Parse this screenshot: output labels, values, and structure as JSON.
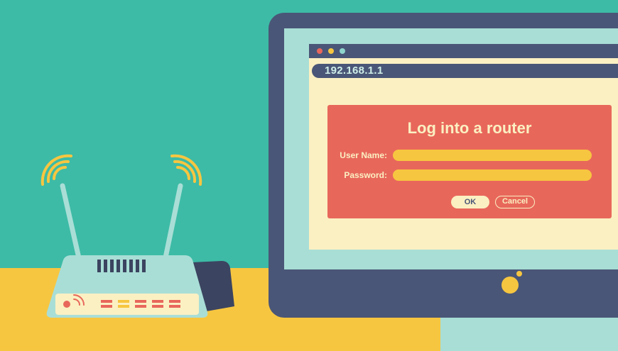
{
  "browser": {
    "address": "192.168.1.1"
  },
  "login": {
    "title": "Log into a router",
    "username_label": "User Name:",
    "password_label": "Password:",
    "username_value": "",
    "password_value": "",
    "ok_label": "OK",
    "cancel_label": "Cancel"
  },
  "colors": {
    "wall": "#3dbba6",
    "desk": "#f7c640",
    "monitor": "#4a5677",
    "screen_bezel": "#a9ded6",
    "browser_bg": "#fbf0c2",
    "panel": "#e8675b",
    "input": "#f7c640"
  },
  "icons": [
    "router-illustration",
    "wifi-signal-icon",
    "monitor-illustration",
    "power-indicator-icon"
  ]
}
